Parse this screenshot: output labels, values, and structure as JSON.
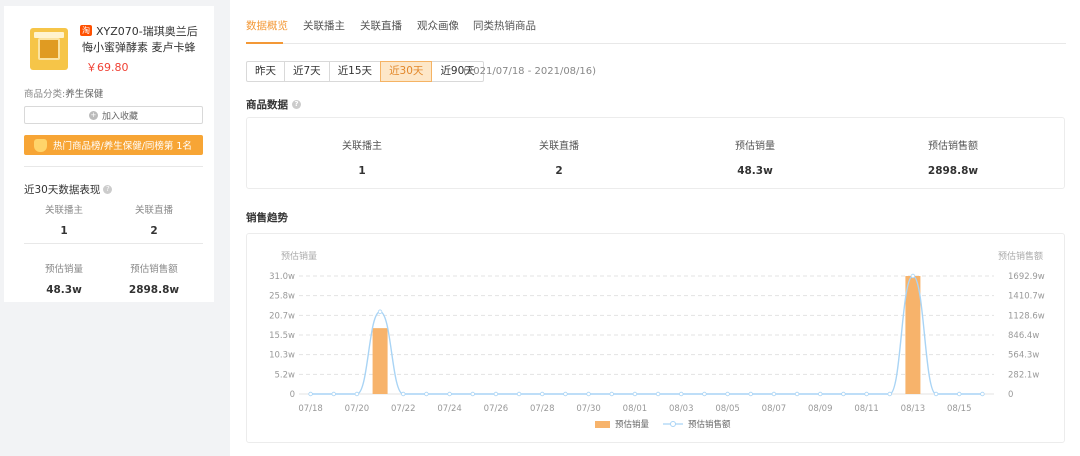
{
  "product": {
    "title": "XYZ070-瑞琪奥兰后悔小蜜弹酵素 麦卢卡蜂蜜果蔬...",
    "badge": "淘",
    "price": "￥69.80",
    "category_key": "商品分类:",
    "category_value": "养生保健",
    "fav_label": "加入收藏",
    "fav_icon": "+",
    "rank_label": "热门商品榜/养生保健/同榜第 1名"
  },
  "left_stats": {
    "title": "近30天数据表现",
    "help_icon": "?",
    "items": [
      {
        "label": "关联播主",
        "value": "1"
      },
      {
        "label": "关联直播",
        "value": "2"
      },
      {
        "label": "预估销量",
        "value": "48.3w"
      },
      {
        "label": "预估销售额",
        "value": "2898.8w"
      }
    ]
  },
  "tabs": [
    "数据概览",
    "关联播主",
    "关联直播",
    "观众画像",
    "同类热销商品"
  ],
  "ranges": {
    "options": [
      "昨天",
      "近7天",
      "近15天",
      "近30天",
      "近90天"
    ],
    "active": 3,
    "date_text": "(2021/07/18 - 2021/08/16)"
  },
  "product_data": {
    "title": "商品数据",
    "metrics": [
      {
        "label": "关联播主",
        "value": "1"
      },
      {
        "label": "关联直播",
        "value": "2"
      },
      {
        "label": "预估销量",
        "value": "48.3w"
      },
      {
        "label": "预估销售额",
        "value": "2898.8w"
      }
    ]
  },
  "trend": {
    "title": "销售趋势"
  },
  "colors": {
    "accent": "#f39836",
    "bar": "#f7b36b",
    "line": "#a9d4f5",
    "price": "#f04134"
  },
  "chart_data": {
    "type": "bar",
    "y_left_label": "预估销量",
    "y_right_label": "预估销售额",
    "y_left_ticks": [
      "0",
      "5.2w",
      "10.3w",
      "15.5w",
      "20.7w",
      "25.8w",
      "31.0w"
    ],
    "y_right_ticks": [
      "0",
      "282.1w",
      "564.3w",
      "846.4w",
      "1128.6w",
      "1410.7w",
      "1692.9w"
    ],
    "x_tick_labels": [
      "07/18",
      "07/20",
      "07/22",
      "07/24",
      "07/26",
      "07/28",
      "07/30",
      "08/01",
      "08/03",
      "08/05",
      "08/07",
      "08/09",
      "08/11",
      "08/13",
      "08/15"
    ],
    "y_left_max": 31.0,
    "y_right_max": 1692.9,
    "x": [
      "07/18",
      "07/19",
      "07/20",
      "07/21",
      "07/22",
      "07/23",
      "07/24",
      "07/25",
      "07/26",
      "07/27",
      "07/28",
      "07/29",
      "07/30",
      "07/31",
      "08/01",
      "08/02",
      "08/03",
      "08/04",
      "08/05",
      "08/06",
      "08/07",
      "08/08",
      "08/09",
      "08/10",
      "08/11",
      "08/12",
      "08/13",
      "08/14",
      "08/15",
      "08/16"
    ],
    "series": [
      {
        "name": "预估销量",
        "kind": "bar",
        "axis": "left",
        "values": [
          0,
          0,
          0,
          17.3,
          0,
          0,
          0,
          0,
          0,
          0,
          0,
          0,
          0,
          0,
          0,
          0,
          0,
          0,
          0,
          0,
          0,
          0,
          0,
          0,
          0,
          0,
          31.0,
          0,
          0,
          0
        ]
      },
      {
        "name": "预估销售额",
        "kind": "line",
        "axis": "right",
        "values": [
          0,
          0,
          0,
          1180,
          0,
          0,
          0,
          0,
          0,
          0,
          0,
          0,
          0,
          0,
          0,
          0,
          0,
          0,
          0,
          0,
          0,
          0,
          0,
          0,
          0,
          0,
          1692.9,
          0,
          0,
          0
        ]
      }
    ],
    "legend": [
      "预估销量",
      "预估销售额"
    ],
    "legend_position": "bottom-center",
    "grid": true
  }
}
